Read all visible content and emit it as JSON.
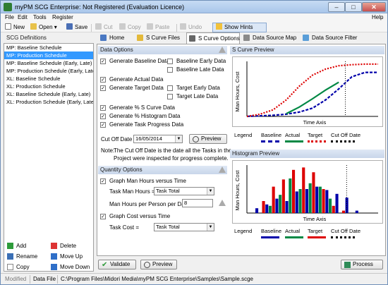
{
  "window": {
    "title": "myPM SCG Enterprise: Not Registered (Evaluation Licence)",
    "min": "–",
    "max": "□",
    "close": "✕"
  },
  "menu": [
    "File",
    "Edit",
    "Tools",
    "Register"
  ],
  "help": "Help",
  "toolbar": {
    "new": "New",
    "open": "Open",
    "save": "Save",
    "cut": "Cut",
    "copy": "Copy",
    "paste": "Paste",
    "undo": "Undo",
    "show_hints": "Show Hints"
  },
  "left": {
    "header": "SCG Definitions",
    "items": [
      "MP: Baseline Schedule",
      "MP: Production Schedule",
      "MP: Baseline Schedule (Early, Late)",
      "MP: Production Schedule (Early, Late)",
      "XL: Baseline Schedule",
      "XL: Production Schedule",
      "XL: Baseline Schedule (Early, Late)",
      "XL: Production Schedule (Early, Late)"
    ],
    "selected": 1,
    "buttons": {
      "add": "Add",
      "delete": "Delete",
      "rename": "Rename",
      "move_up": "Move Up",
      "copy": "Copy",
      "move_down": "Move Down"
    }
  },
  "tabs": [
    "Home",
    "S Curve Files",
    "S Curve Options",
    "Data Source Map",
    "Data Source Filter"
  ],
  "data_options": {
    "title": "Data Options",
    "gen_baseline": "Generate Baseline Data",
    "baseline_early": "Baseline Early Data",
    "baseline_late": "Baseline Late Data",
    "gen_actual": "Generate Actual Data",
    "gen_target": "Generate Target Data",
    "target_early": "Target Early Data",
    "target_late": "Target Late Data",
    "gen_pct_scurve": "Generate % S Curve Data",
    "gen_pct_hist": "Generate % Histogram Data",
    "gen_task_progress": "Generate Task Progress Data",
    "cutoff_label": "Cut Off Date",
    "cutoff_value": "16/05/2014",
    "preview": "Preview",
    "note_label": "Note:",
    "note_line1": "The Cut Off Date is the date all the Tasks in the",
    "note_line2": "Project were inspected for progress complete."
  },
  "quantity_options": {
    "title": "Quantity Options",
    "graph_man_hours": "Graph Man Hours versus Time",
    "task_man_hours_label": "Task Man Hours =",
    "task_man_hours_value": "Task Total",
    "per_day_label": "Man Hours per Person per Day",
    "per_day_value": "8",
    "graph_cost": "Graph Cost versus Time",
    "task_cost_label": "Task Cost =",
    "task_cost_value": "Task Total"
  },
  "scurve_preview": {
    "title": "S Curve Preview",
    "ylabel": "Man Hours, Cost",
    "xlabel": "Time Axis"
  },
  "hist_preview": {
    "title": "Histogram Preview",
    "ylabel": "Man Hours, Cost",
    "xlabel": "Time Axis"
  },
  "legend": {
    "label": "Legend",
    "baseline": "Baseline",
    "actual": "Actual",
    "target": "Target",
    "cutoff": "Cut Off Date"
  },
  "colors": {
    "baseline": "#0000aa",
    "actual": "#008844",
    "target": "#dd0000",
    "cutoff": "#000000"
  },
  "bottom": {
    "validate": "Validate",
    "preview": "Preview",
    "process": "Process"
  },
  "status": {
    "mode": "Modified",
    "data_file_label": "Data File",
    "data_file_path": "C:\\Program Files\\Midori Media\\myPM SCG Enterprise\\Samples\\Sample.scge"
  },
  "chart_data": [
    {
      "type": "line",
      "title": "S Curve Preview",
      "xlabel": "Time Axis",
      "ylabel": "Man Hours, Cost",
      "cutoff_x": 0.75,
      "series": [
        {
          "name": "Baseline",
          "x": [
            0.0,
            0.1,
            0.2,
            0.3,
            0.4,
            0.5,
            0.6,
            0.7,
            0.8,
            0.9,
            1.0
          ],
          "values": [
            0,
            0.01,
            0.02,
            0.04,
            0.08,
            0.15,
            0.3,
            0.5,
            0.72,
            0.8,
            0.8
          ]
        },
        {
          "name": "Actual",
          "x": [
            0.3,
            0.4,
            0.5,
            0.6,
            0.7
          ],
          "values": [
            0.05,
            0.17,
            0.32,
            0.48,
            0.62
          ]
        },
        {
          "name": "Target",
          "x": [
            0.0,
            0.1,
            0.2,
            0.3,
            0.4,
            0.5,
            0.6,
            0.7,
            0.8,
            0.9,
            1.0
          ],
          "values": [
            0,
            0.04,
            0.12,
            0.3,
            0.55,
            0.75,
            0.86,
            0.92,
            0.94,
            0.95,
            0.95
          ]
        }
      ]
    },
    {
      "type": "bar",
      "title": "Histogram Preview",
      "xlabel": "Time Axis",
      "ylabel": "Man Hours, Cost",
      "cutoff_x": 0.76,
      "series": [
        {
          "name": "Baseline",
          "values": [
            0.1,
            0.18,
            0.3,
            0.25,
            0.45,
            0.5,
            0.55,
            0.48,
            0.4,
            0.32,
            0.05
          ]
        },
        {
          "name": "Actual",
          "values": [
            0,
            0.15,
            0.38,
            0.72,
            0.5,
            0.62,
            0.55,
            0.3,
            0,
            0,
            0
          ]
        },
        {
          "name": "Target",
          "values": [
            0.25,
            0.55,
            0.7,
            0.9,
            0.95,
            0.85,
            0.5,
            0.15,
            0.05,
            0,
            0
          ]
        }
      ]
    }
  ]
}
